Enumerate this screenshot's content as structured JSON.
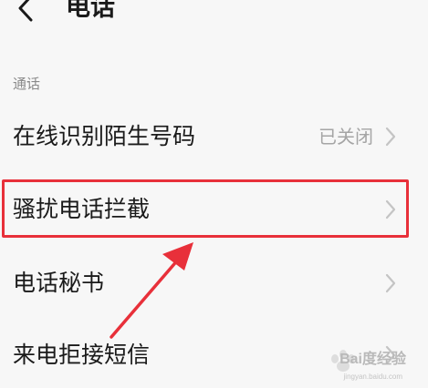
{
  "header": {
    "title": "电话",
    "back_icon": "chevron-left-icon"
  },
  "section": {
    "label": "通话"
  },
  "rows": [
    {
      "label": "在线识别陌生号码",
      "value": "已关闭",
      "icon": "chevron-right-icon"
    },
    {
      "label": "骚扰电话拦截",
      "value": "",
      "icon": "chevron-right-icon"
    },
    {
      "label": "电话秘书",
      "value": "",
      "icon": "chevron-right-icon"
    },
    {
      "label": "来电拒接短信",
      "value": "",
      "icon": "chevron-right-icon"
    }
  ],
  "annotation": {
    "highlight_color": "#e8303a",
    "arrow_color": "#e8303a"
  },
  "watermark": {
    "brand": "Bai度经验",
    "url": "jingyan.baidu.com"
  }
}
